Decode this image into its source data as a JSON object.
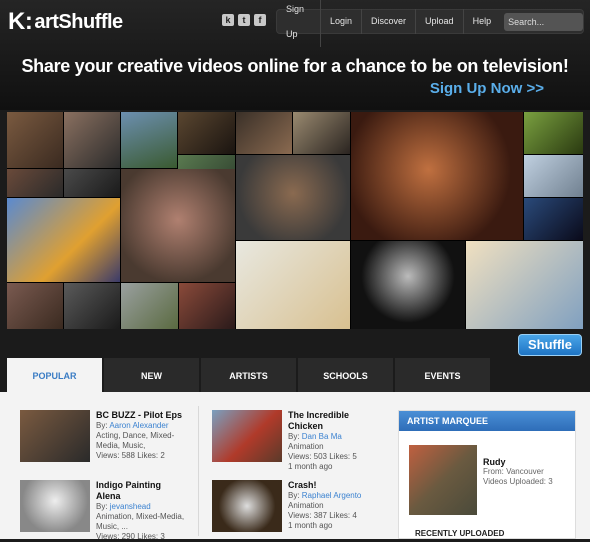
{
  "logo": {
    "mark": "K:",
    "name": "artShuffle"
  },
  "social": [
    {
      "icon": "k-icon",
      "glyph": "k"
    },
    {
      "icon": "twitter-icon",
      "glyph": "t"
    },
    {
      "icon": "facebook-icon",
      "glyph": "f"
    }
  ],
  "nav": {
    "items": [
      "Sign Up",
      "Login",
      "Discover",
      "Upload",
      "Help"
    ],
    "search_placeholder": "Search..."
  },
  "tagline": "Share your creative videos online for a chance to be on television!",
  "signup_cta": "Sign Up Now >>",
  "shuffle_button": "Shuffle",
  "tabs": [
    "POPULAR",
    "NEW",
    "ARTISTS",
    "SCHOOLS",
    "EVENTS"
  ],
  "videos": [
    {
      "title": "BC BUZZ - Pilot Eps",
      "by_prefix": "By: ",
      "author": "Aaron Alexander",
      "line1": "Acting, Dance, Mixed-",
      "line2": "Media, Music,",
      "line3": "Views: 588 Likes: 2"
    },
    {
      "title": "Indigo Painting",
      "title2": "Alena",
      "by_prefix": "By: ",
      "author": "jevanshead",
      "line1": "Animation, Mixed-Media,",
      "line2": "Music, ...",
      "line3": "Views: 290 Likes: 3"
    },
    {
      "title": "The Incredible",
      "title2": "Chicken",
      "by_prefix": "By: ",
      "author": "Dan Ba Ma",
      "line1": "Animation",
      "line2": "Views: 503 Likes: 5",
      "line3": "1 month ago"
    },
    {
      "title": "Crash!",
      "by_prefix": "By: ",
      "author": "Raphael Argento",
      "line1": "Animation",
      "line2": "Views: 387 Likes: 4",
      "line3": "1 month ago"
    }
  ],
  "marquee": {
    "heading": "ARTIST MARQUEE",
    "name": "Rudy",
    "from": "From: Vancouver",
    "uploads": "Videos Uploaded: 3",
    "recent": "RECENTLY UPLOADED"
  },
  "colors": {
    "accent": "#3b82d0",
    "cta": "#5aaeea",
    "header": "#1b1b1b"
  }
}
